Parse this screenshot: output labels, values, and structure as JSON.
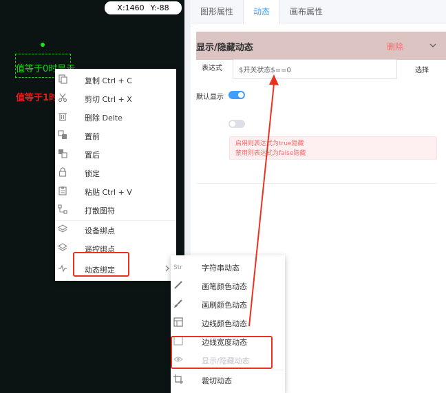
{
  "canvas": {
    "coords": {
      "x": "X:1460",
      "y": "Y:-88"
    },
    "text_green": "值等于0时显示",
    "text_red": "值等于1时"
  },
  "panel": {
    "tabs": [
      "图形属性",
      "动态",
      "画布属性"
    ],
    "active_tab": "动态",
    "section": {
      "title": "显示/隐藏动态",
      "delete": "删除",
      "expr_label": "表达式",
      "expr_value": "$开关状态$==0",
      "select": "选择",
      "default_label": "默认显示",
      "default_on": true,
      "second_toggle_on": false,
      "hint_lines": [
        "启用则表达式为true隐藏",
        "禁用则表达式为false隐藏"
      ]
    }
  },
  "context_menu": {
    "items": [
      {
        "label": "复制 Ctrl + C",
        "icon": "copy-icon"
      },
      {
        "label": "剪切 Ctrl + X",
        "icon": "scissors-icon"
      },
      {
        "label": "删除 Delte",
        "icon": "trash-icon"
      },
      {
        "label": "置前",
        "icon": "bring-front-icon"
      },
      {
        "label": "置后",
        "icon": "send-back-icon"
      },
      {
        "label": "锁定",
        "icon": "lock-icon"
      },
      {
        "label": "粘贴 Ctrl + V",
        "icon": "paste-icon"
      },
      {
        "label": "打散图符",
        "icon": "ungroup-icon"
      },
      {
        "label": "设备绑点",
        "icon": "layers-icon"
      },
      {
        "label": "遥控绑点",
        "icon": "layers-icon"
      },
      {
        "label": "动态绑定",
        "icon": "pulse-icon"
      }
    ]
  },
  "sub_menu": {
    "items": [
      {
        "label": "字符串动态",
        "icon": "string-icon",
        "disabled": false
      },
      {
        "label": "画笔颜色动态",
        "icon": "pen-icon",
        "disabled": false
      },
      {
        "label": "画刷颜色动态",
        "icon": "brush-icon",
        "disabled": false
      },
      {
        "label": "边线颜色动态",
        "icon": "border-color-icon",
        "disabled": false
      },
      {
        "label": "边线宽度动态",
        "icon": "border-width-icon",
        "disabled": false
      },
      {
        "label": "显示/隐藏动态",
        "icon": "eye-icon",
        "disabled": true
      },
      {
        "label": "裁切动态",
        "icon": "crop-icon",
        "disabled": false
      }
    ]
  },
  "colors": {
    "canvas_bg": "#0b1313",
    "accent": "#409eff",
    "danger": "#f56c6c",
    "highlight": "#e8311f",
    "text_green": "#1fd11f"
  }
}
